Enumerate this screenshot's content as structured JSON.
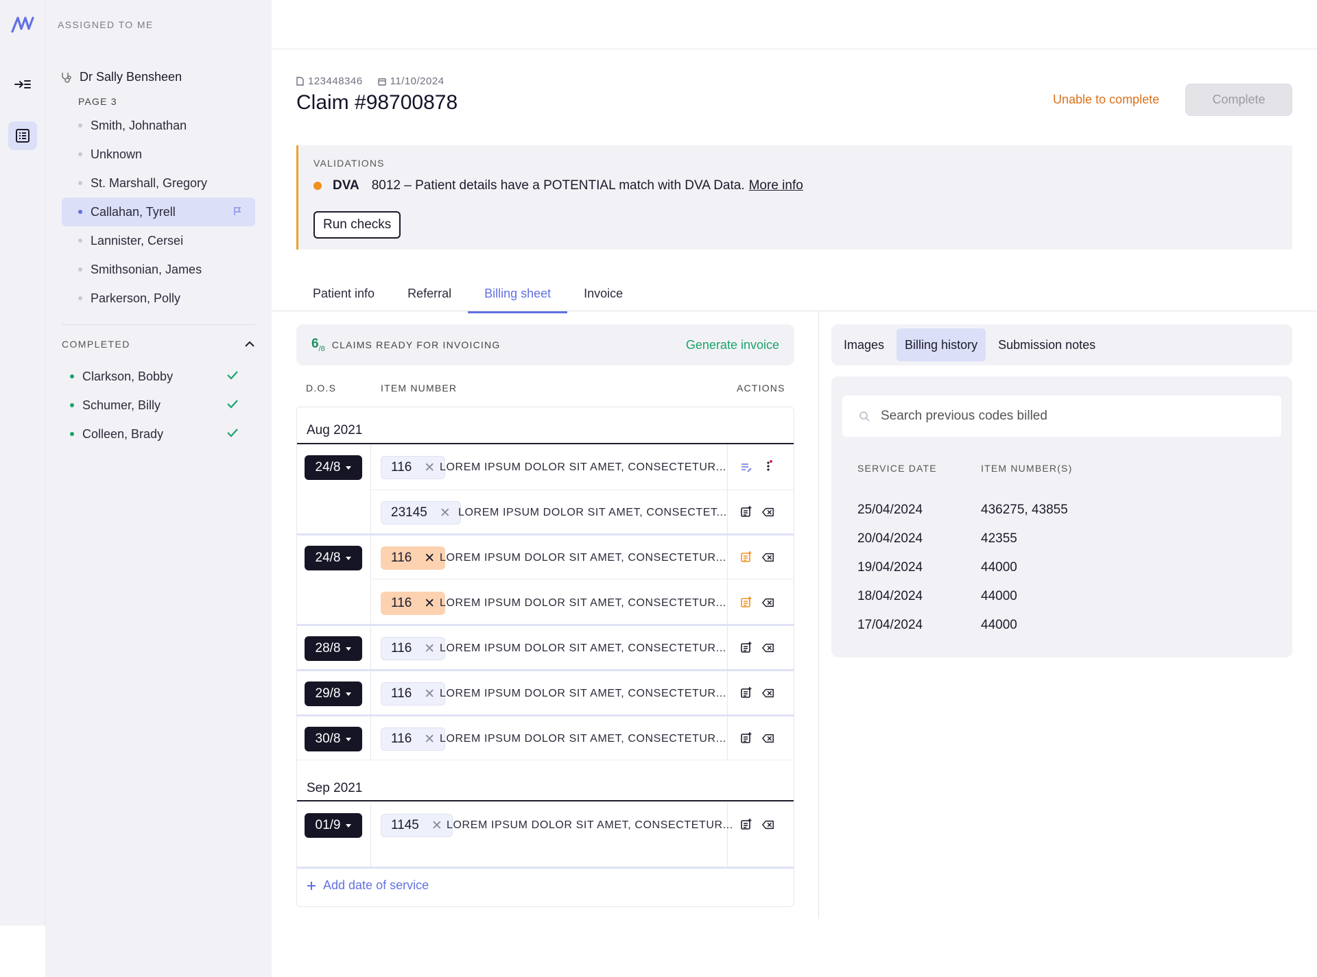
{
  "rail": {
    "logo_icon": "brand-logo-icon",
    "items": [
      "collapse-menu-icon",
      "list-icon"
    ]
  },
  "sidebar": {
    "header": "ASSIGNED TO ME",
    "doctor": "Dr Sally Bensheen",
    "page_label": "PAGE 3",
    "patients": [
      {
        "name": "Smith, Johnathan",
        "selected": false
      },
      {
        "name": "Unknown",
        "selected": false
      },
      {
        "name": "St. Marshall, Gregory",
        "selected": false
      },
      {
        "name": "Callahan, Tyrell",
        "selected": true
      },
      {
        "name": "Lannister, Cersei",
        "selected": false
      },
      {
        "name": "Smithsonian, James",
        "selected": false
      },
      {
        "name": "Parkerson, Polly",
        "selected": false
      }
    ],
    "completed_label": "COMPLETED",
    "completed": [
      "Clarkson, Bobby",
      "Schumer, Billy",
      "Colleen, Brady"
    ]
  },
  "claim": {
    "id_meta": "123448346",
    "date_meta": "11/10/2024",
    "title": "Claim #98700878",
    "unable_label": "Unable to complete",
    "complete_label": "Complete"
  },
  "validations": {
    "label": "VALIDATIONS",
    "code": "DVA",
    "message": "8012 – Patient details have a POTENTIAL match with DVA Data.",
    "link": "More info",
    "run_label": "Run checks"
  },
  "tabs": [
    "Patient info",
    "Referral",
    "Billing sheet",
    "Invoice"
  ],
  "active_tab": "Billing sheet",
  "billing": {
    "ready_num": "6",
    "ready_den": "/8",
    "ready_text": "CLAIMS READY FOR INVOICING",
    "generate_label": "Generate invoice",
    "columns": [
      "D.O.S",
      "ITEM NUMBER",
      "ACTIONS"
    ],
    "months": [
      "Aug 2021",
      "Sep 2021"
    ],
    "dates": [
      "24/8",
      "24/8",
      "28/8",
      "29/8",
      "30/8",
      "01/9"
    ],
    "items": [
      {
        "code": "116",
        "desc": "LOREM IPSUM DOLOR SIT AMET, CONSECTETUR...",
        "warn": false
      },
      {
        "code": "23145",
        "desc": "LOREM IPSUM DOLOR SIT AMET, CONSECTET...",
        "warn": false
      },
      {
        "code": "116",
        "desc": "LOREM IPSUM DOLOR SIT AMET, CONSECTETUR...",
        "warn": true
      },
      {
        "code": "116",
        "desc": "LOREM IPSUM DOLOR SIT AMET, CONSECTETUR...",
        "warn": true
      },
      {
        "code": "116",
        "desc": "LOREM IPSUM DOLOR SIT AMET, CONSECTETUR...",
        "warn": false
      },
      {
        "code": "116",
        "desc": "LOREM IPSUM DOLOR SIT AMET, CONSECTETUR...",
        "warn": false
      },
      {
        "code": "116",
        "desc": "LOREM IPSUM DOLOR SIT AMET, CONSECTETUR...",
        "warn": false
      },
      {
        "code": "1145",
        "desc": "LOREM IPSUM DOLOR SIT AMET, CONSECTETUR...",
        "warn": false
      }
    ],
    "add_label": "Add date of service",
    "colors": {
      "accent": "#6271e3",
      "warn": "#fcd2b0",
      "orange": "#f0901e",
      "green": "#1ba36b"
    }
  },
  "right": {
    "tabs": [
      "Images",
      "Billing history",
      "Submission notes"
    ],
    "active_tab": "Billing history",
    "search_placeholder": "Search previous codes billed",
    "columns": [
      "SERVICE DATE",
      "ITEM NUMBER(S)"
    ],
    "rows": [
      {
        "date": "25/04/2024",
        "items": "436275, 43855"
      },
      {
        "date": "20/04/2024",
        "items": "42355"
      },
      {
        "date": "19/04/2024",
        "items": "44000"
      },
      {
        "date": "18/04/2024",
        "items": "44000"
      },
      {
        "date": "17/04/2024",
        "items": "44000"
      }
    ]
  }
}
